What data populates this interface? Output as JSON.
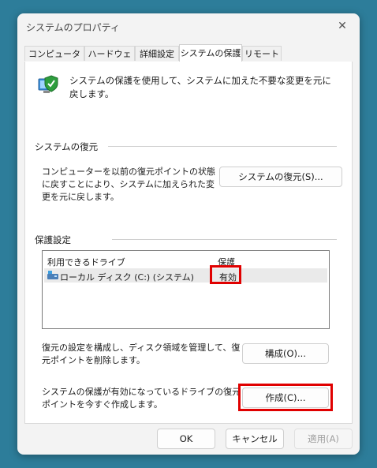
{
  "window": {
    "title": "システムのプロパティ",
    "close_glyph": "✕"
  },
  "tabs": [
    {
      "label": "コンピューター名",
      "active": false
    },
    {
      "label": "ハードウェア",
      "active": false
    },
    {
      "label": "詳細設定",
      "active": false
    },
    {
      "label": "システムの保護",
      "active": true
    },
    {
      "label": "リモート",
      "active": false
    }
  ],
  "intro": {
    "icon": "system-protection-icon",
    "text": "システムの保護を使用して、システムに加えた不要な変更を元に戻します。"
  },
  "restore": {
    "group_label": "システムの復元",
    "description": "コンピューターを以前の復元ポイントの状態に戻すことにより、システムに加えられた変更を元に戻します。",
    "button": "システムの復元(S)..."
  },
  "protection": {
    "group_label": "保護設定",
    "columns": [
      "利用できるドライブ",
      "保護"
    ],
    "drives": [
      {
        "icon": "drive-icon",
        "name": "ローカル ディスク (C:) (システム)",
        "status": "有効"
      }
    ],
    "configure_text": "復元の設定を構成し、ディスク領域を管理して、復元ポイントを削除します。",
    "configure_button": "構成(O)...",
    "create_text": "システムの保護が有効になっているドライブの復元ポイントを今すぐ作成します。",
    "create_button": "作成(C)..."
  },
  "footer": {
    "ok": "OK",
    "cancel": "キャンセル",
    "apply": "適用(A)"
  },
  "colors": {
    "highlight": "#e00000",
    "background": "#2d7d9a"
  }
}
